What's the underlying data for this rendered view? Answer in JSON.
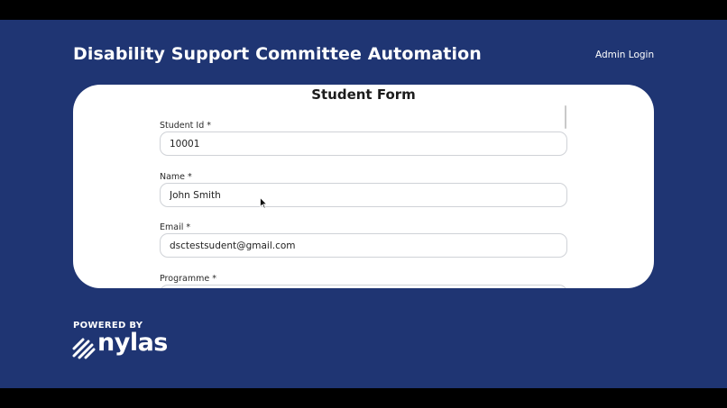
{
  "header": {
    "title": "Disability Support Committee Automation",
    "admin_link": "Admin Login"
  },
  "form": {
    "title": "Student Form",
    "fields": [
      {
        "label": "Student Id *",
        "value": "10001"
      },
      {
        "label": "Name *",
        "value": "John Smith"
      },
      {
        "label": "Email *",
        "value": "dsctestsudent@gmail.com"
      },
      {
        "label": "Programme *",
        "value": ""
      }
    ]
  },
  "footer": {
    "powered_by": "POWERED BY",
    "brand": "nylas"
  },
  "colors": {
    "background": "#1f3573",
    "card": "#ffffff",
    "text_light": "#ffffff",
    "input_border": "#cfd2d7"
  },
  "icons": {
    "cursor": "mouse-pointer-icon",
    "logo_mark": "nylas-logo-icon"
  }
}
